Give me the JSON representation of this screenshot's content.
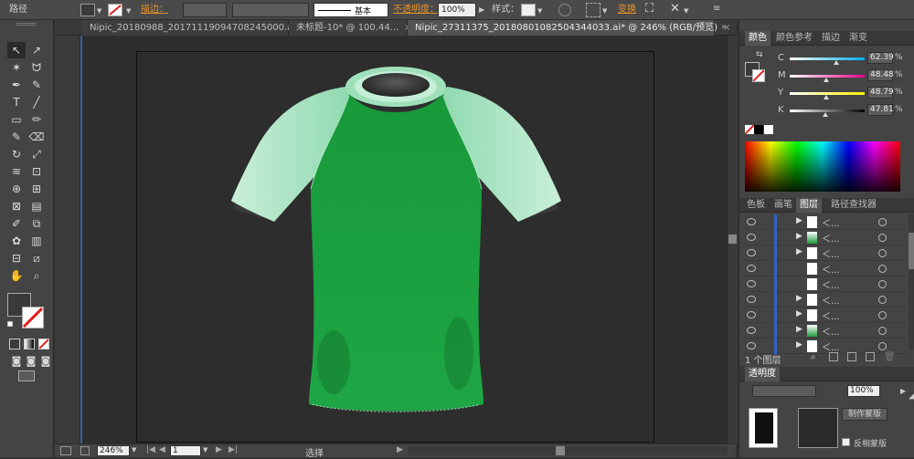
{
  "control_bar": {
    "object_type": "路径",
    "stroke_label": "描边：",
    "stroke_profile": "基本",
    "opacity_label": "不透明度：",
    "opacity_value": "100%",
    "style_label": "样式：",
    "transform_label": "变换"
  },
  "tabs": [
    {
      "label": "Nipic_20180988_20171119094708245000.ai*",
      "active": false
    },
    {
      "label": "未标题-10* @ 100.44...",
      "active": false
    },
    {
      "label": "Nipic_27311375_20180801082504344033.ai* @ 246% (RGB/预览)",
      "active": true
    }
  ],
  "tab_close": "×",
  "tools": {
    "icons": [
      "selection-tool-icon",
      "direct-selection-tool-icon",
      "magic-wand-icon",
      "lasso-icon",
      "pen-tool-icon",
      "curvature-icon",
      "type-tool-icon",
      "line-tool-icon",
      "rectangle-tool-icon",
      "paintbrush-icon",
      "pencil-icon",
      "eraser-icon",
      "rotate-icon",
      "scale-icon",
      "warp-icon",
      "free-transform-icon",
      "shape-builder-icon",
      "perspective-icon",
      "mesh-icon",
      "gradient-icon",
      "eyedropper-icon",
      "blend-icon",
      "symbol-sprayer-icon",
      "graph-icon",
      "artboard-icon",
      "slice-icon",
      "hand-icon",
      "zoom-icon"
    ],
    "glyphs": [
      "↖",
      "↗",
      "✶",
      "ᗢ",
      "✒",
      "✎",
      "T",
      "╱",
      "▭",
      "✏",
      "✎",
      "⌫",
      "↻",
      "⤢",
      "≋",
      "⊡",
      "⊕",
      "⊞",
      "⊠",
      "▤",
      "✐",
      "⧉",
      "✿",
      "▥",
      "⊟",
      "⧄",
      "✋",
      "⌕"
    ]
  },
  "color_panel": {
    "tabs": [
      "颜色",
      "颜色参考",
      "描边",
      "渐变"
    ],
    "channels": [
      {
        "name": "C",
        "value": "62.39"
      },
      {
        "name": "M",
        "value": "48.48"
      },
      {
        "name": "Y",
        "value": "48.79"
      },
      {
        "name": "K",
        "value": "47.81"
      }
    ]
  },
  "layers_panel": {
    "tabs": [
      "色板",
      "画笔",
      "图层",
      "路径查找器"
    ],
    "row_label": "＜...",
    "row_count": 9,
    "footer": "1 个图层"
  },
  "transparency_panel": {
    "title": "透明度",
    "value": "100%",
    "mode_button": "制作蒙版",
    "checkbox": "反相蒙版"
  },
  "status_bar": {
    "zoom": "246%",
    "page": "1",
    "tool": "选择"
  },
  "colors": {
    "shirt_body": "#1a9a3a",
    "sleeve": "#a6e3c1",
    "accent_orange": "#e8922a"
  }
}
